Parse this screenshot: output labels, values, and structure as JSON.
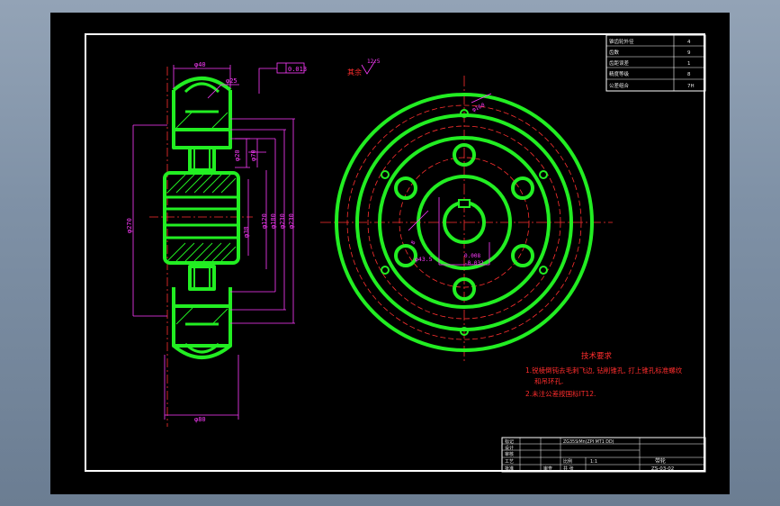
{
  "drawing": {
    "property_table": {
      "rows": [
        {
          "name": "锥齿轮外径",
          "value": "4"
        },
        {
          "name": "齿数",
          "value": "9"
        },
        {
          "name": "齿距误差",
          "value": "1"
        },
        {
          "name": "精度等级",
          "value": "8"
        },
        {
          "name": "公差组合",
          "value": "7H"
        }
      ]
    },
    "roughness_note": "其余",
    "roughness_value": "12.5",
    "dimensions": {
      "top_width": "φ40",
      "tolerance_frame": "0.013",
      "r25": "φ25",
      "d20": "φ20",
      "d70": "φ70",
      "d270": "φ270",
      "d38": "φ38",
      "d120": "φ120",
      "d230": "φ230",
      "d180": "φ180",
      "d230b": "φ230",
      "bottom_width": "φ80",
      "bore": "φ43.5",
      "bore_tol_upper": "0.008",
      "bore_tol_lower": "-0.032",
      "keyway": "8",
      "pcd": "φ160"
    },
    "tech_requirements": {
      "title": "技术要求",
      "line1": "1.锐棱倒钝去毛刺飞边, 钻削锥孔, 打上锥孔标准螺纹",
      "line1b": "和吊环孔.",
      "line2": "2.未注公差按国标IT12."
    },
    "title_block": {
      "r1c1": "标记",
      "r2c1": "设计",
      "r3c1": "审核",
      "r4c1": "工艺",
      "r5c1": "批准",
      "material": "ZG35SiMn(ZPI MT1 DD)",
      "scale_label": "比例",
      "scale": "1:1",
      "sheet_label": "共 张",
      "part_name": "带轮",
      "drawing_no": "ZS-03-02",
      "signer": "审查"
    }
  },
  "colors": {
    "geometry": "#22ee22",
    "dimension": "#ff3bff",
    "centerline": "#ff3030",
    "frame": "#ffffff"
  }
}
